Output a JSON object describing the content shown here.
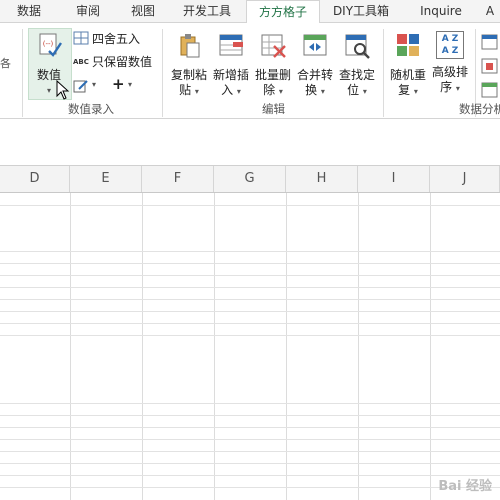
{
  "tabs": [
    "数据",
    "审阅",
    "视图",
    "开发工具",
    "方方格子",
    "DIY工具箱",
    "Inquire",
    "A"
  ],
  "active_tab": "方方格子",
  "ribbon": {
    "left_fragment": "各",
    "numeric_group": {
      "value_button": "数值",
      "round_label": "四舍五入",
      "keep_values_label": "只保留数值",
      "abc_icon_text": "ABC",
      "plus_label": "+",
      "group_label": "数值录入"
    },
    "edit_group": {
      "buttons": [
        {
          "line1": "复制粘",
          "line2": "贴"
        },
        {
          "line1": "新增插",
          "line2": "入"
        },
        {
          "line1": "批量删",
          "line2": "除"
        },
        {
          "line1": "合并转",
          "line2": "换"
        },
        {
          "line1": "查找定",
          "line2": "位"
        }
      ],
      "group_label": "编辑"
    },
    "analysis_group": {
      "buttons": [
        {
          "line1": "随机重",
          "line2": "复"
        },
        {
          "line1": "高级排",
          "line2": "序"
        }
      ],
      "sort_icon_text": "A Z",
      "group_label": "数据分析"
    }
  },
  "columns": [
    "D",
    "E",
    "F",
    "G",
    "H",
    "I",
    "J"
  ],
  "watermark": "Bai 经验"
}
